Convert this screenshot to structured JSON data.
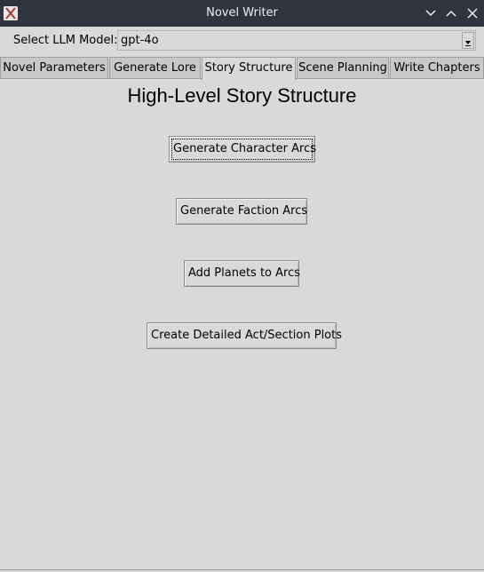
{
  "window": {
    "title": "Novel Writer",
    "icons": [
      "app-icon",
      "minimize-icon",
      "maximize-icon",
      "close-icon"
    ]
  },
  "model": {
    "label": "Select LLM Model:",
    "value": "gpt-4o"
  },
  "tabs": [
    {
      "label": "Novel Parameters",
      "active": false
    },
    {
      "label": "Generate Lore",
      "active": false
    },
    {
      "label": "Story Structure",
      "active": true
    },
    {
      "label": "Scene Planning",
      "active": false
    },
    {
      "label": "Write Chapters",
      "active": false
    }
  ],
  "panel": {
    "title": "High-Level Story Structure",
    "buttons": {
      "character_arcs": "Generate Character Arcs",
      "faction_arcs": "Generate Faction Arcs",
      "planets": "Add Planets to Arcs",
      "act_plots": "Create Detailed Act/Section Plots"
    }
  },
  "colors": {
    "titlebar": "#2f343f",
    "window_bg": "#d9d9d9",
    "tab_inactive": "#c8c8c8"
  }
}
